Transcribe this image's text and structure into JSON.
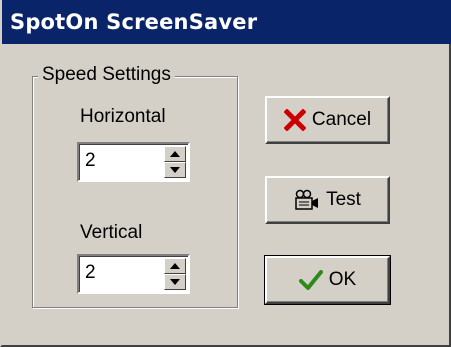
{
  "window": {
    "title": "SpotOn ScreenSaver"
  },
  "speed_settings": {
    "group_label": "Speed Settings",
    "horizontal": {
      "label": "Horizontal",
      "value": "2"
    },
    "vertical": {
      "label": "Vertical",
      "value": "2"
    }
  },
  "buttons": {
    "cancel": {
      "label": "Cancel",
      "icon": "x-icon",
      "icon_color": "#cc0000"
    },
    "test": {
      "label": "Test",
      "icon": "projector-icon"
    },
    "ok": {
      "label": "OK",
      "icon": "checkmark-icon",
      "icon_color": "#2a8a1a"
    }
  },
  "colors": {
    "title_bar": "#0a246a",
    "dialog_face": "#d4d0c8"
  }
}
